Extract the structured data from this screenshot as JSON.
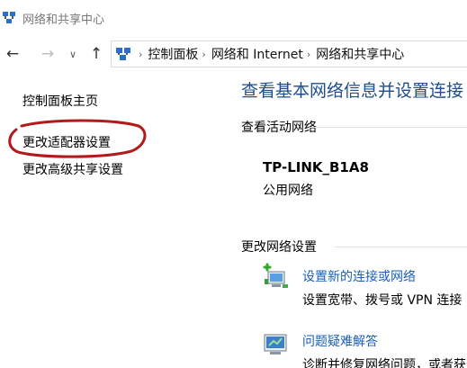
{
  "window": {
    "title": "网络和共享中心",
    "icon": "network-center-icon"
  },
  "nav": {
    "back_icon": "arrow-left-icon",
    "forward_icon": "arrow-right-icon",
    "recent_icon": "chevron-down-icon",
    "up_icon": "arrow-up-icon",
    "back_glyph": "←",
    "forward_glyph": "→",
    "recent_glyph": "∨",
    "up_glyph": "↑"
  },
  "address": {
    "separator": "›",
    "crumbs": [
      "控制面板",
      "网络和 Internet",
      "网络和共享中心"
    ]
  },
  "left_pane": {
    "home": "控制面板主页",
    "adapter": "更改适配器设置",
    "advanced": "更改高级共享设置",
    "highlight_color": "#b01c1c"
  },
  "main": {
    "heading": "查看基本网络信息并设置连接",
    "active_networks_label": "查看活动网络",
    "network": {
      "name": "TP-LINK_B1A8",
      "type": "公用网络"
    },
    "change_settings_label": "更改网络设置",
    "tasks": [
      {
        "icon": "new-connection-icon",
        "link": "设置新的连接或网络",
        "desc": "设置宽带、拨号或 VPN 连接"
      },
      {
        "icon": "troubleshoot-icon",
        "link": "问题疑难解答",
        "desc": "诊断并修复网络问题，或者获"
      }
    ]
  },
  "colors": {
    "heading": "#1e4e8c",
    "link": "#1a5fb4",
    "annotation": "#b01c1c"
  }
}
